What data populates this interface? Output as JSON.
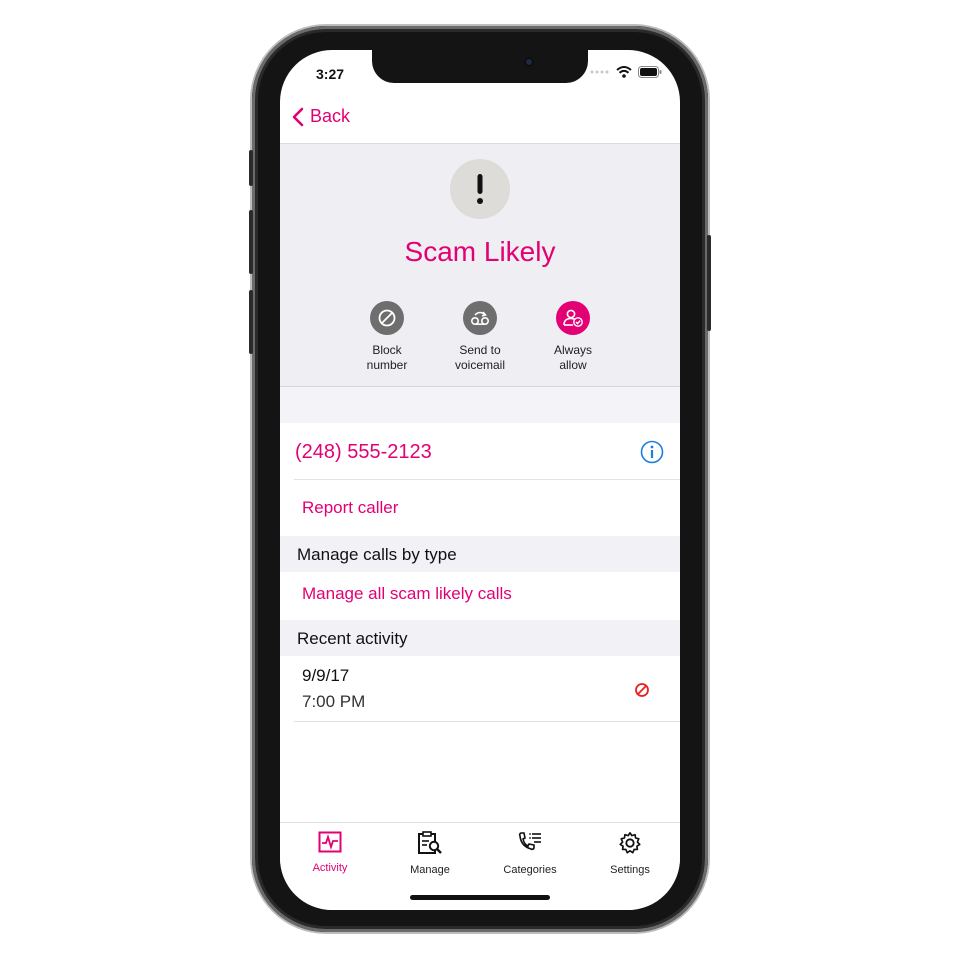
{
  "status_bar": {
    "time": "3:27"
  },
  "nav": {
    "back_label": "Back"
  },
  "caller": {
    "name": "Scam Likely",
    "icon": "exclamation-icon"
  },
  "actions": [
    {
      "label": "Block\nnumber",
      "icon": "block-icon",
      "active": false
    },
    {
      "label": "Send to\nvoicemail",
      "icon": "voicemail-icon",
      "active": false
    },
    {
      "label": "Always\nallow",
      "icon": "allow-contact-icon",
      "active": true
    }
  ],
  "phone_number": "(248) 555-2123",
  "report_caller": "Report caller",
  "manage_section": {
    "header": "Manage calls by type",
    "link": "Manage all scam likely calls"
  },
  "recent_section": {
    "header": "Recent activity",
    "items": [
      {
        "date": "9/9/17",
        "time": "7:00 PM",
        "icon": "blocked-icon"
      }
    ]
  },
  "tabs": [
    {
      "label": "Activity",
      "icon": "activity-icon",
      "active": true
    },
    {
      "label": "Manage",
      "icon": "manage-icon",
      "active": false
    },
    {
      "label": "Categories",
      "icon": "categories-icon",
      "active": false
    },
    {
      "label": "Settings",
      "icon": "settings-icon",
      "active": false
    }
  ],
  "colors": {
    "accent": "#e20074",
    "info": "#1a7fe0",
    "gray_icon": "#6e6e6e"
  }
}
